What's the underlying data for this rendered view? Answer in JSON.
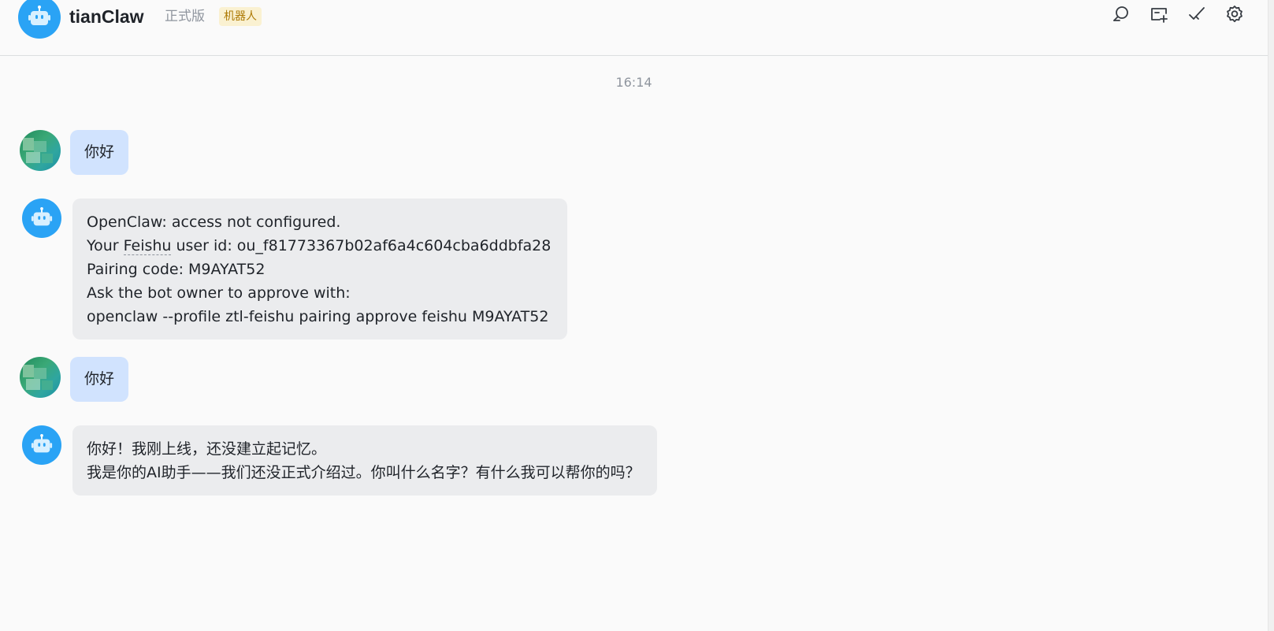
{
  "header": {
    "title": "tianClaw",
    "edition": "正式版",
    "badge": "机器人",
    "actions": [
      {
        "name": "search-chat-icon"
      },
      {
        "name": "add-tab-icon"
      },
      {
        "name": "mark-done-icon"
      },
      {
        "name": "settings-gear-icon"
      }
    ]
  },
  "chat": {
    "timestamp": "16:14",
    "messages": [
      {
        "from": "user",
        "text": "你好"
      },
      {
        "from": "bot",
        "lines": [
          "OpenClaw: access not configured.",
          "Your Feishu user id: ou_f81773367b02af6a4c604cba6ddbfa28",
          "Pairing code: M9AYAT52",
          "Ask the bot owner to approve with:",
          "openclaw --profile ztl-feishu pairing approve feishu M9AYAT52"
        ],
        "prefix_before_underline": "Your ",
        "underlined_word": "Feishu",
        "suffix_after_underline": " user id: ou_f81773367b02af6a4c604cba6ddbfa28"
      },
      {
        "from": "user",
        "text": "你好"
      },
      {
        "from": "bot",
        "lines": [
          "你好！我刚上线，还没建立起记忆。",
          "我是你的AI助手——我们还没正式介绍过。你叫什么名字？有什么我可以帮你的吗？"
        ]
      }
    ]
  },
  "colors": {
    "brand_blue": "#2aa3f5",
    "user_bubble": "#d1e3fe",
    "bot_bubble": "#ebecee",
    "badge_bg": "#faf1d1",
    "badge_text": "#ad7a05"
  }
}
